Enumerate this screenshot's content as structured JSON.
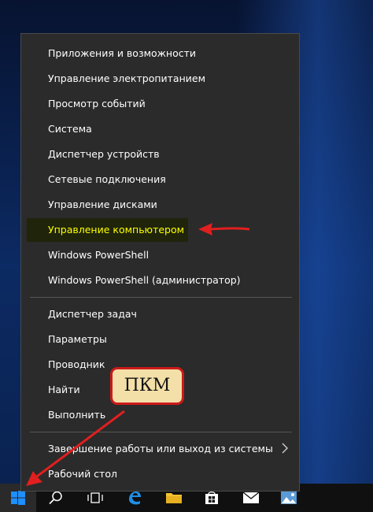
{
  "menu": {
    "group1": [
      {
        "label": "Приложения и возможности"
      },
      {
        "label": "Управление электропитанием"
      },
      {
        "label": "Просмотр событий"
      },
      {
        "label": "Система"
      },
      {
        "label": "Диспетчер устройств"
      },
      {
        "label": "Сетевые подключения"
      },
      {
        "label": "Управление дисками"
      },
      {
        "label": "Управление компьютером",
        "highlighted": true
      },
      {
        "label": "Windows PowerShell"
      },
      {
        "label": "Windows PowerShell (администратор)"
      }
    ],
    "group2": [
      {
        "label": "Диспетчер задач"
      },
      {
        "label": "Параметры"
      },
      {
        "label": "Проводник"
      },
      {
        "label": "Найти"
      },
      {
        "label": "Выполнить"
      }
    ],
    "group3": [
      {
        "label": "Завершение работы или выход из системы",
        "has_submenu": true
      },
      {
        "label": "Рабочий стол"
      }
    ]
  },
  "annotation": {
    "badge_text": "ПКМ",
    "color": "#e01f1f"
  },
  "taskbar": {
    "icons": [
      "windows-start-icon",
      "search-icon",
      "task-view-icon",
      "edge-icon",
      "file-explorer-icon",
      "store-icon",
      "mail-icon",
      "photos-icon"
    ]
  },
  "colors": {
    "menu_bg": "#2b2b2b",
    "highlight_text": "#ffff00",
    "taskbar_bg": "#101010"
  }
}
